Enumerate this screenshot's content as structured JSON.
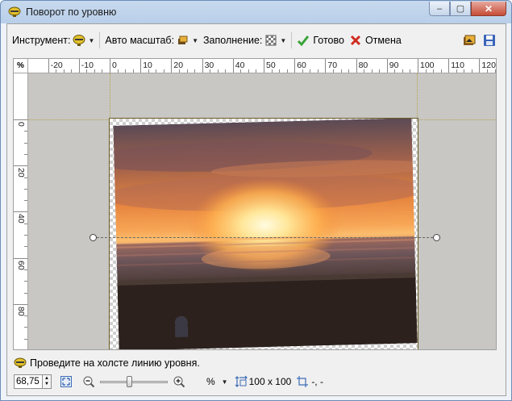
{
  "window": {
    "title": "Поворот по уровню",
    "controls": {
      "minimize": "–",
      "maximize": "▢",
      "close": "✕"
    }
  },
  "toolbar": {
    "tool_label": "Инструмент:",
    "autoscale_label": "Авто масштаб:",
    "fill_label": "Заполнение:",
    "done_label": "Готово",
    "cancel_label": "Отмена"
  },
  "ruler": {
    "unit": "%",
    "top_ticks": [
      "-20",
      "-10",
      "0",
      "10",
      "20",
      "30",
      "40",
      "50",
      "60",
      "70",
      "80",
      "90",
      "100",
      "110",
      "120"
    ],
    "left_ticks": [
      "0",
      "20",
      "40",
      "60",
      "80",
      "100"
    ]
  },
  "status": {
    "hint": "Проведите на холсте линию уровня."
  },
  "bottom": {
    "zoom_value": "68,75",
    "units_label": "%",
    "size_value": "100 x 100",
    "position_value": "-, -"
  },
  "colors": {
    "done_check": "#3aa33a",
    "cancel_x": "#d12b1f",
    "canvas_bg": "#c8c7c4"
  }
}
